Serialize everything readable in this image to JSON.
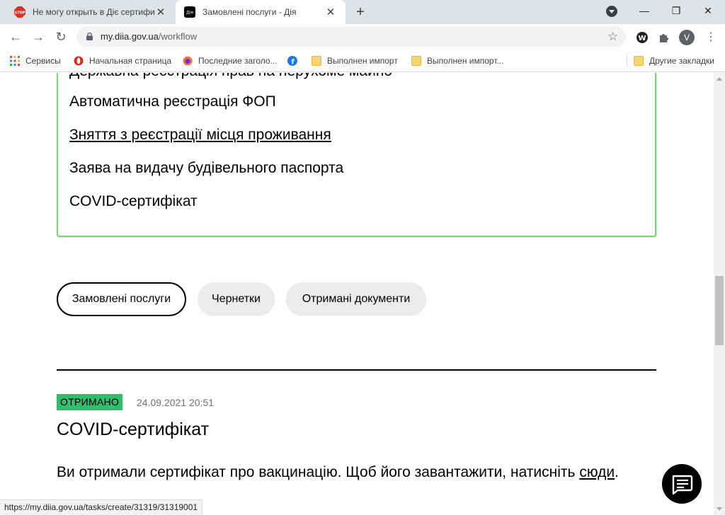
{
  "tabs": [
    {
      "title": "Не могу открыть в Діє сертифик",
      "favicon": "stop-icon"
    },
    {
      "title": "Замовлені послуги - Дія",
      "favicon": "diia-icon",
      "favicon_text": "Дія"
    }
  ],
  "address_bar": {
    "host": "my.diia.gov.ua",
    "path": "/workflow"
  },
  "profile_initial": "V",
  "bookmarks": [
    {
      "label": "Сервисы",
      "icon": "apps-grid-icon"
    },
    {
      "label": "Начальная страница",
      "icon": "opera-icon"
    },
    {
      "label": "Последние заголо...",
      "icon": "firefox-icon"
    },
    {
      "label": "",
      "icon": "facebook-icon"
    },
    {
      "label": "Выполнен импорт",
      "icon": "folder-icon"
    },
    {
      "label": "Выполнен импорт...",
      "icon": "folder-icon"
    },
    {
      "label": "Другие закладки",
      "icon": "folder-icon"
    }
  ],
  "services": {
    "partial_item": "Державна реєстрація прав на нерухоме майно",
    "items": [
      "Автоматична реєстрація ФОП",
      "Зняття з реєстрації місця проживання",
      "Заява на видачу будівельного паспорта",
      "COVID-сертифікат"
    ]
  },
  "filters": [
    {
      "label": "Замовлені послуги",
      "active": true
    },
    {
      "label": "Чернетки",
      "active": false
    },
    {
      "label": "Отримані документи",
      "active": false
    }
  ],
  "order": {
    "status": "ОТРИМАНО",
    "datetime": "24.09.2021 20:51",
    "title": "COVID-сертифікат",
    "message": "Ви отримали сертифікат про вакцинацію. Щоб його завантажити, натисніть",
    "link_text": "сюди",
    "message_end": "."
  },
  "status_bar_url": "https://my.diia.gov.ua/tasks/create/31319/31319001",
  "colors": {
    "accent_green_border": "#64e364",
    "status_badge_green": "#2fbe6c",
    "tab_strip": "#dee1e6"
  }
}
